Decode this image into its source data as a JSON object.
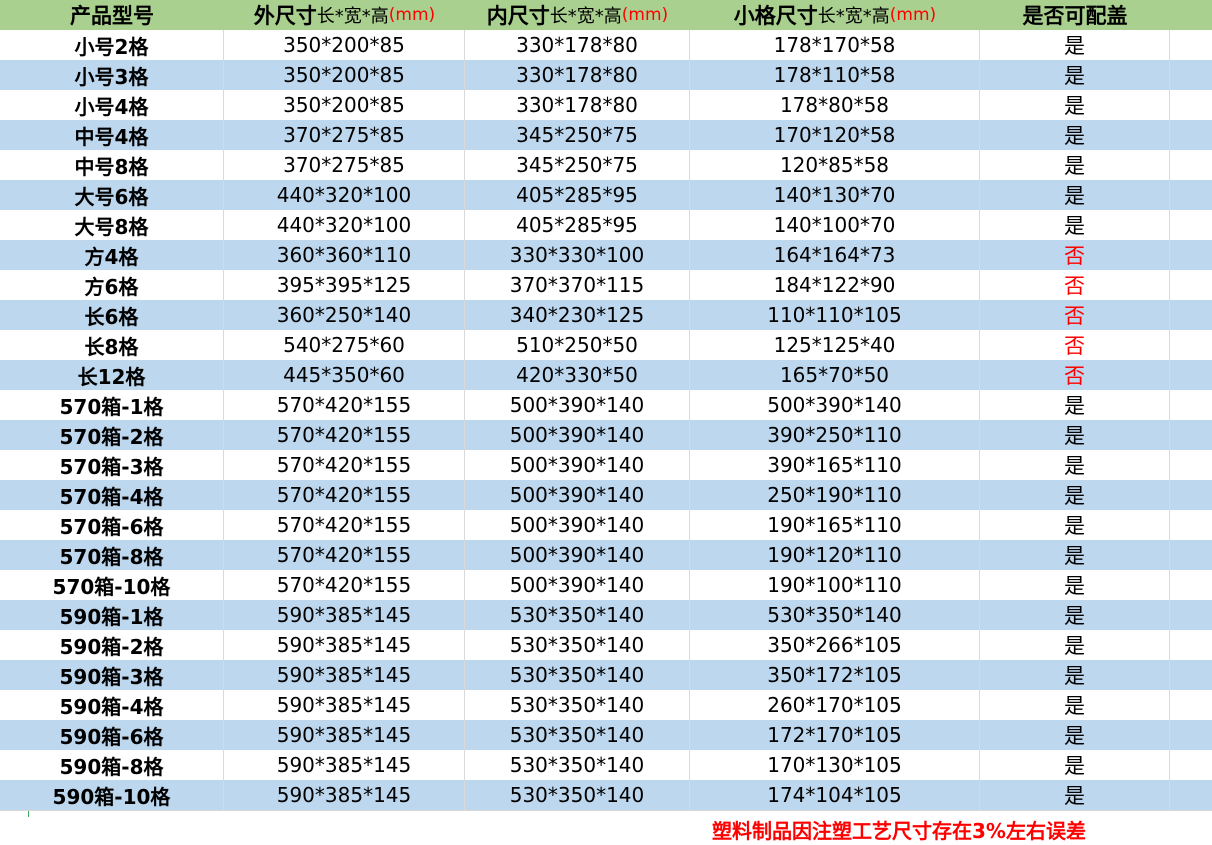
{
  "header": {
    "model": "产品型号",
    "outer_main": "外尺寸",
    "outer_sub": "长*宽*高",
    "outer_unit": "(mm)",
    "inner_main": "内尺寸",
    "inner_sub": "长*宽*高",
    "inner_unit": "(mm)",
    "cell_main": "小格尺寸",
    "cell_sub": "长*宽*高",
    "cell_unit": "(mm)",
    "lid": "是否可配盖"
  },
  "colors": {
    "header_bg": "#a9d08e",
    "stripe_bg": "#bdd7ee",
    "alert": "#ff0000"
  },
  "rows": [
    {
      "model": "小号2格",
      "outer": "350*200*85",
      "inner": "330*178*80",
      "cell": "178*170*58",
      "lid": "是"
    },
    {
      "model": "小号3格",
      "outer": "350*200*85",
      "inner": "330*178*80",
      "cell": "178*110*58",
      "lid": "是"
    },
    {
      "model": "小号4格",
      "outer": "350*200*85",
      "inner": "330*178*80",
      "cell": "178*80*58",
      "lid": "是"
    },
    {
      "model": "中号4格",
      "outer": "370*275*85",
      "inner": "345*250*75",
      "cell": "170*120*58",
      "lid": "是"
    },
    {
      "model": "中号8格",
      "outer": "370*275*85",
      "inner": "345*250*75",
      "cell": "120*85*58",
      "lid": "是"
    },
    {
      "model": "大号6格",
      "outer": "440*320*100",
      "inner": "405*285*95",
      "cell": "140*130*70",
      "lid": "是"
    },
    {
      "model": "大号8格",
      "outer": "440*320*100",
      "inner": "405*285*95",
      "cell": "140*100*70",
      "lid": "是"
    },
    {
      "model": "方4格",
      "outer": "360*360*110",
      "inner": "330*330*100",
      "cell": "164*164*73",
      "lid": "否"
    },
    {
      "model": "方6格",
      "outer": "395*395*125",
      "inner": "370*370*115",
      "cell": "184*122*90",
      "lid": "否"
    },
    {
      "model": "长6格",
      "outer": "360*250*140",
      "inner": "340*230*125",
      "cell": "110*110*105",
      "lid": "否"
    },
    {
      "model": "长8格",
      "outer": "540*275*60",
      "inner": "510*250*50",
      "cell": "125*125*40",
      "lid": "否"
    },
    {
      "model": "长12格",
      "outer": "445*350*60",
      "inner": "420*330*50",
      "cell": "165*70*50",
      "lid": "否"
    },
    {
      "model": "570箱-1格",
      "outer": "570*420*155",
      "inner": "500*390*140",
      "cell": "500*390*140",
      "lid": "是"
    },
    {
      "model": "570箱-2格",
      "outer": "570*420*155",
      "inner": "500*390*140",
      "cell": "390*250*110",
      "lid": "是"
    },
    {
      "model": "570箱-3格",
      "outer": "570*420*155",
      "inner": "500*390*140",
      "cell": "390*165*110",
      "lid": "是"
    },
    {
      "model": "570箱-4格",
      "outer": "570*420*155",
      "inner": "500*390*140",
      "cell": "250*190*110",
      "lid": "是"
    },
    {
      "model": "570箱-6格",
      "outer": "570*420*155",
      "inner": "500*390*140",
      "cell": "190*165*110",
      "lid": "是"
    },
    {
      "model": "570箱-8格",
      "outer": "570*420*155",
      "inner": "500*390*140",
      "cell": "190*120*110",
      "lid": "是"
    },
    {
      "model": "570箱-10格",
      "outer": "570*420*155",
      "inner": "500*390*140",
      "cell": "190*100*110",
      "lid": "是"
    },
    {
      "model": "590箱-1格",
      "outer": "590*385*145",
      "inner": "530*350*140",
      "cell": "530*350*140",
      "lid": "是"
    },
    {
      "model": "590箱-2格",
      "outer": "590*385*145",
      "inner": "530*350*140",
      "cell": "350*266*105",
      "lid": "是"
    },
    {
      "model": "590箱-3格",
      "outer": "590*385*145",
      "inner": "530*350*140",
      "cell": "350*172*105",
      "lid": "是"
    },
    {
      "model": "590箱-4格",
      "outer": "590*385*145",
      "inner": "530*350*140",
      "cell": "260*170*105",
      "lid": "是"
    },
    {
      "model": "590箱-6格",
      "outer": "590*385*145",
      "inner": "530*350*140",
      "cell": "172*170*105",
      "lid": "是"
    },
    {
      "model": "590箱-8格",
      "outer": "590*385*145",
      "inner": "530*350*140",
      "cell": "170*130*105",
      "lid": "是"
    },
    {
      "model": "590箱-10格",
      "outer": "590*385*145",
      "inner": "530*350*140",
      "cell": "174*104*105",
      "lid": "是"
    }
  ],
  "note": "塑料制品因注塑工艺尺寸存在3%左右误差"
}
